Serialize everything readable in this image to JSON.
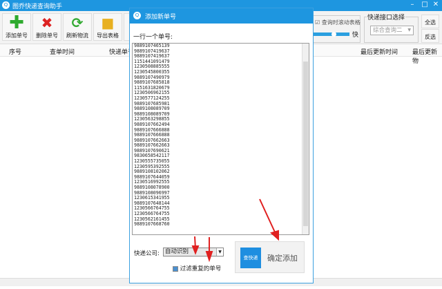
{
  "app": {
    "title": "图乔快递查询助手"
  },
  "toolbar": {
    "buttons": [
      {
        "label": "添加单号"
      },
      {
        "label": "删除单号"
      },
      {
        "label": "刷新物流"
      },
      {
        "label": "导出表格"
      }
    ],
    "scroll_option": "查询时滚动表格",
    "speed_label": "快",
    "speed_value": 0.5,
    "api_group_title": "快递接口选择",
    "api_selected": "综合查询二",
    "select_all": "全选",
    "invert_select": "反选"
  },
  "table": {
    "columns": [
      "序号",
      "查单时间",
      "快递单号",
      "最后更新时间",
      "最后更新物"
    ]
  },
  "dialog": {
    "title": "添加新单号",
    "prompt": "一行一个单号:",
    "tracking_numbers": [
      "9889107465139",
      "9889107419637",
      "9889107419637",
      "1151441091479",
      "1230508885555",
      "1230545800355",
      "9889107490979",
      "9889107685818",
      "1151631820679",
      "1230506962155",
      "1230577124255",
      "9889107685981",
      "9889108089709",
      "9889108089709",
      "1230563298855",
      "9889107662494",
      "9889107666888",
      "9889107666888",
      "9889107662663",
      "9889107662663",
      "9889107690621",
      "9830658542117",
      "1230555735055",
      "1230595392555",
      "9889108102062",
      "9889107644059",
      "1230516992555",
      "9889108078900",
      "9889108096997",
      "1230615341955",
      "9889107648144",
      "1230566764755",
      "1230566764755",
      "1230562161455",
      "9889107668760"
    ],
    "company_label": "快递公司:",
    "company_value": "自动识别",
    "filter_label": "过滤重复的单号",
    "filter_checked": true,
    "logo_text": "查快递",
    "confirm_label": "确定添加"
  }
}
